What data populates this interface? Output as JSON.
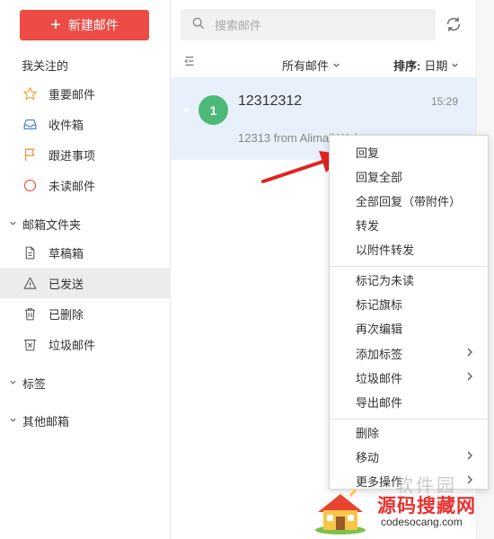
{
  "sidebar": {
    "new_mail_label": "新建邮件",
    "favorites_header": "我关注的",
    "favorites": [
      {
        "label": "重要邮件",
        "icon": "star-icon"
      },
      {
        "label": "收件箱",
        "icon": "inbox-icon"
      },
      {
        "label": "跟进事项",
        "icon": "flag-icon"
      },
      {
        "label": "未读邮件",
        "icon": "circle-icon"
      }
    ],
    "folders_header": "邮箱文件夹",
    "folders": [
      {
        "label": "草稿箱",
        "icon": "draft-icon"
      },
      {
        "label": "已发送",
        "icon": "sent-icon",
        "active": true
      },
      {
        "label": "已删除",
        "icon": "trash-icon"
      },
      {
        "label": "垃圾邮件",
        "icon": "spam-icon"
      }
    ],
    "tags_header": "标签",
    "other_header": "其他邮箱"
  },
  "search": {
    "placeholder": "搜索邮件"
  },
  "list_toolbar": {
    "filter_label": "所有邮件",
    "sort_label": "排序:",
    "sort_value": "日期"
  },
  "mail": {
    "avatar_letter": "1",
    "from": "12312312",
    "time": "15:29",
    "preview": "12313 from Alimail Web"
  },
  "context_menu": {
    "group1": [
      "回复",
      "回复全部",
      "全部回复（带附件）",
      "转发",
      "以附件转发"
    ],
    "group2": [
      "标记为未读",
      "标记旗标",
      "再次编辑",
      "添加标签",
      "垃圾邮件",
      "导出邮件"
    ],
    "group3": [
      "删除",
      "移动",
      "更多操作"
    ]
  },
  "watermark": {
    "title": "源码搜藏网",
    "url": "codesocang.com",
    "ghost": "软件园"
  },
  "colors": {
    "accent": "#ec4c45",
    "selected_bg": "#e8f1fb",
    "avatar": "#4cb979"
  }
}
